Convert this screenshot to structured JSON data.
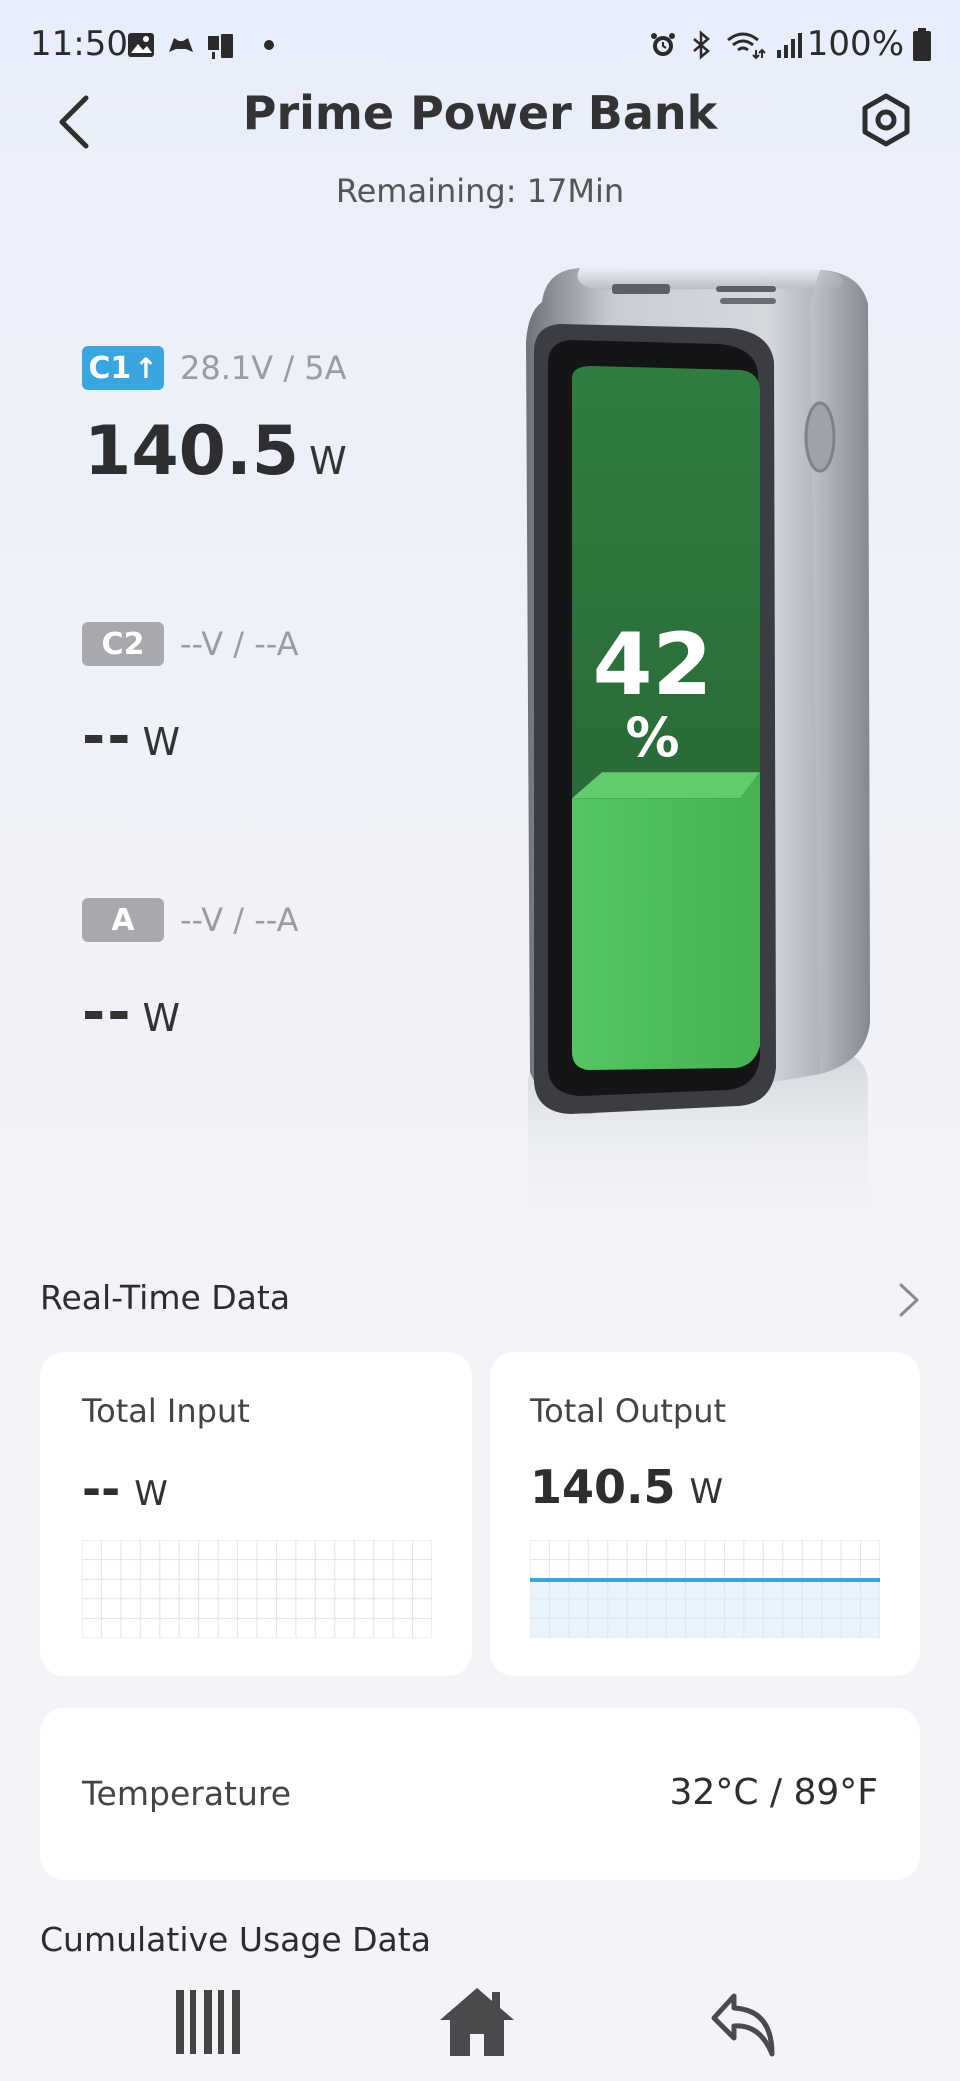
{
  "status_bar": {
    "time": "11:50",
    "battery_percent": "100%",
    "left_icons": [
      "gallery-icon",
      "game-controller-icon",
      "device-icon",
      "dot-icon"
    ],
    "right_icons": [
      "alarm-icon",
      "bluetooth-icon",
      "wifi-6e-icon",
      "signal-icon",
      "battery-icon"
    ]
  },
  "header": {
    "title": "Prime Power Bank",
    "remaining": "Remaining: 17Min"
  },
  "ports": [
    {
      "badge": "C1",
      "arrow": "↑",
      "spec": "28.1V / 5A",
      "power": "140.5",
      "unit": "W",
      "active": true
    },
    {
      "badge": "C2",
      "spec": "--V / --A",
      "power": "--",
      "unit": "W",
      "active": false
    },
    {
      "badge": "A",
      "spec": "--V / --A",
      "power": "--",
      "unit": "W",
      "active": false
    }
  ],
  "battery": {
    "level": 42,
    "level_text": "42",
    "percent_sign": "%",
    "fill_color": "#4cbf56"
  },
  "realtime": {
    "title": "Real-Time Data",
    "total_input": {
      "label": "Total Input",
      "value": "--",
      "unit": "W"
    },
    "total_output": {
      "label": "Total Output",
      "value": "140.5",
      "unit": "W"
    },
    "line_color": "#3aa6d8"
  },
  "temperature": {
    "label": "Temperature",
    "value": "32°C / 89°F"
  },
  "cumulative": {
    "title": "Cumulative Usage Data"
  },
  "nav": {
    "icons": [
      "recents-icon",
      "home-icon",
      "back-icon"
    ]
  }
}
